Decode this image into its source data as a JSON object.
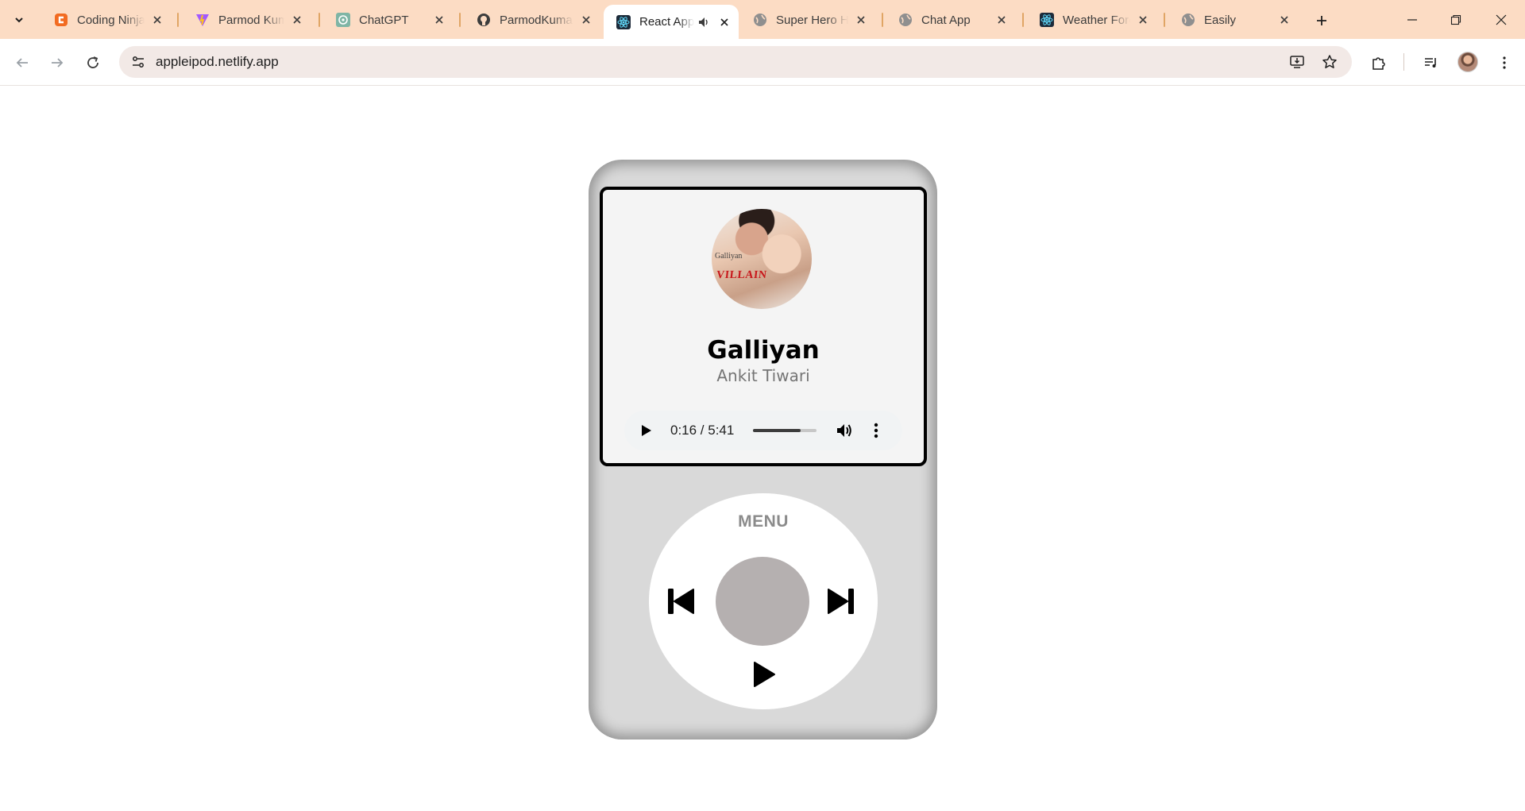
{
  "tabs": [
    {
      "title": "Coding Ninjas",
      "icon": "coding-ninjas-icon"
    },
    {
      "title": "Parmod Kumar",
      "icon": "vite-icon"
    },
    {
      "title": "ChatGPT",
      "icon": "chatgpt-icon"
    },
    {
      "title": "ParmodKumar",
      "icon": "github-icon"
    },
    {
      "title": "React App",
      "icon": "react-icon",
      "active": true,
      "audio": true
    },
    {
      "title": "Super Hero Hunter",
      "icon": "globe-icon"
    },
    {
      "title": "Chat App",
      "icon": "globe-icon"
    },
    {
      "title": "Weather Forecast",
      "icon": "react-icon"
    },
    {
      "title": "Easily",
      "icon": "globe-icon"
    }
  ],
  "address_bar": {
    "url": "appleipod.netlify.app"
  },
  "song": {
    "title": "Galliyan",
    "artist": "Ankit Tiwari",
    "cover_small_text": "Galliyan",
    "cover_big_text": "VILLAIN"
  },
  "audio_player": {
    "time_display": "0:16 / 5:41",
    "volume_level": 0.75
  },
  "wheel": {
    "menu_label": "MENU"
  },
  "colors": {
    "tabstrip_bg": "#fcdcc4",
    "ipod_body": "#d9d9d9",
    "center_button": "#b5b0b0",
    "menu_text": "#8b8b8b"
  }
}
